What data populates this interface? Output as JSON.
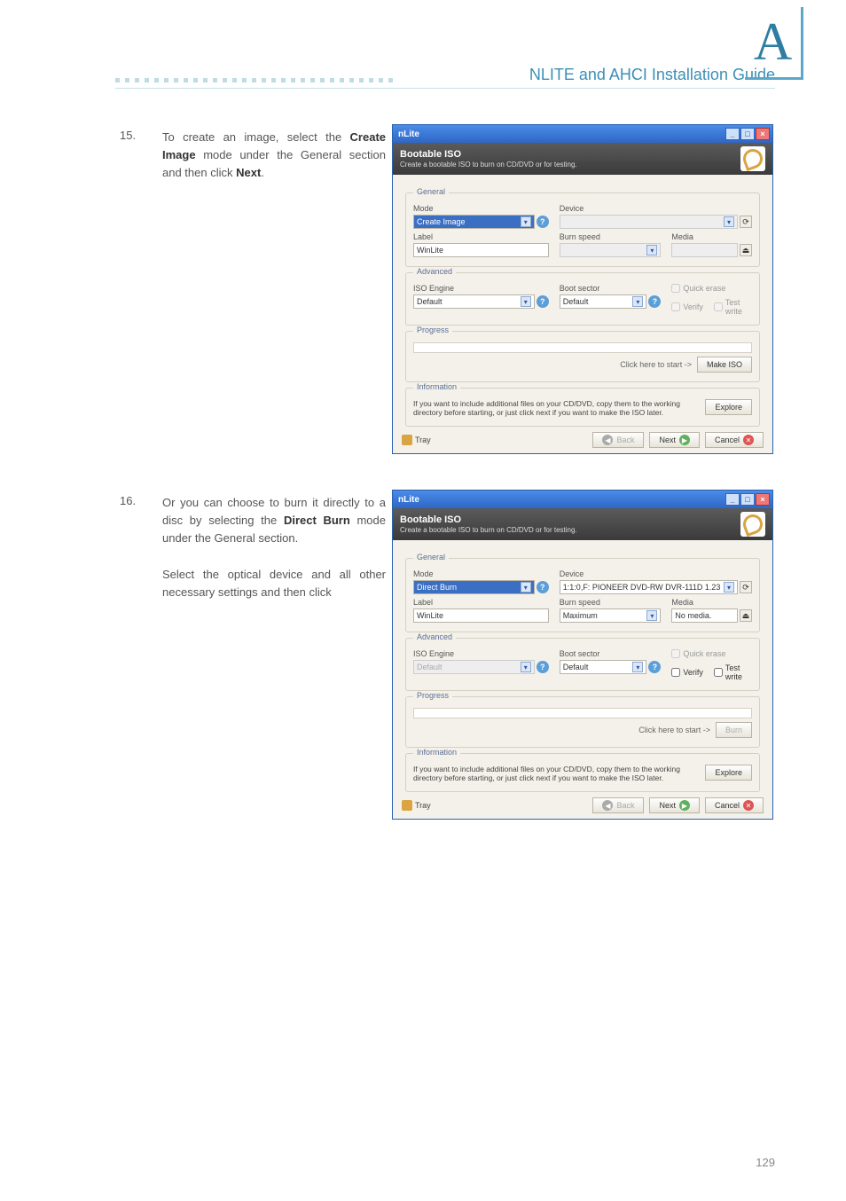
{
  "header": {
    "title": "NLITE and AHCI Installation Guide",
    "bigLetter": "A"
  },
  "steps": {
    "s15": {
      "num": "15.",
      "html": "To create an image, select the <b>Create Image</b> mode under the General section and then click <b>Next</b>."
    },
    "s16": {
      "num": "16.",
      "html1": "Or you can choose to burn it directly to a disc by selecting the <b>Direct Burn</b> mode under the General section.",
      "html2": "Select the optical device and all other necessary settings and then click"
    }
  },
  "win": {
    "title": "nLite",
    "banner": {
      "title": "Bootable ISO",
      "sub": "Create a bootable ISO to burn on CD/DVD or for testing."
    },
    "legends": {
      "general": "General",
      "advanced": "Advanced",
      "progress": "Progress",
      "information": "Information"
    },
    "labels": {
      "mode": "Mode",
      "device": "Device",
      "label": "Label",
      "burnSpeed": "Burn speed",
      "media": "Media",
      "isoEngine": "ISO Engine",
      "bootSector": "Boot sector",
      "quickErase": "Quick erase",
      "verify": "Verify",
      "testWrite": "Test write",
      "startHint": "Click here to start ->"
    },
    "buttons": {
      "makeIso": "Make ISO",
      "burn": "Burn",
      "explore": "Explore",
      "tray": "Tray",
      "back": "Back",
      "next": "Next",
      "cancel": "Cancel"
    },
    "infoText": "If you want to include additional files on your CD/DVD, copy them to the working directory before starting, or just click next if you want to make the ISO later."
  },
  "win1": {
    "mode": "Create Image",
    "device": "",
    "label": "WinLite",
    "burnSpeed": "",
    "media": "",
    "isoEngine": "Default",
    "bootSector": "Default"
  },
  "win2": {
    "mode": "Direct Burn",
    "device": "1:1:0,F: PIONEER  DVD-RW  DVR-111D 1.23",
    "label": "WinLite",
    "burnSpeed": "Maximum",
    "media": "No media.",
    "isoEngine": "Default",
    "bootSector": "Default"
  },
  "pageNum": "129"
}
